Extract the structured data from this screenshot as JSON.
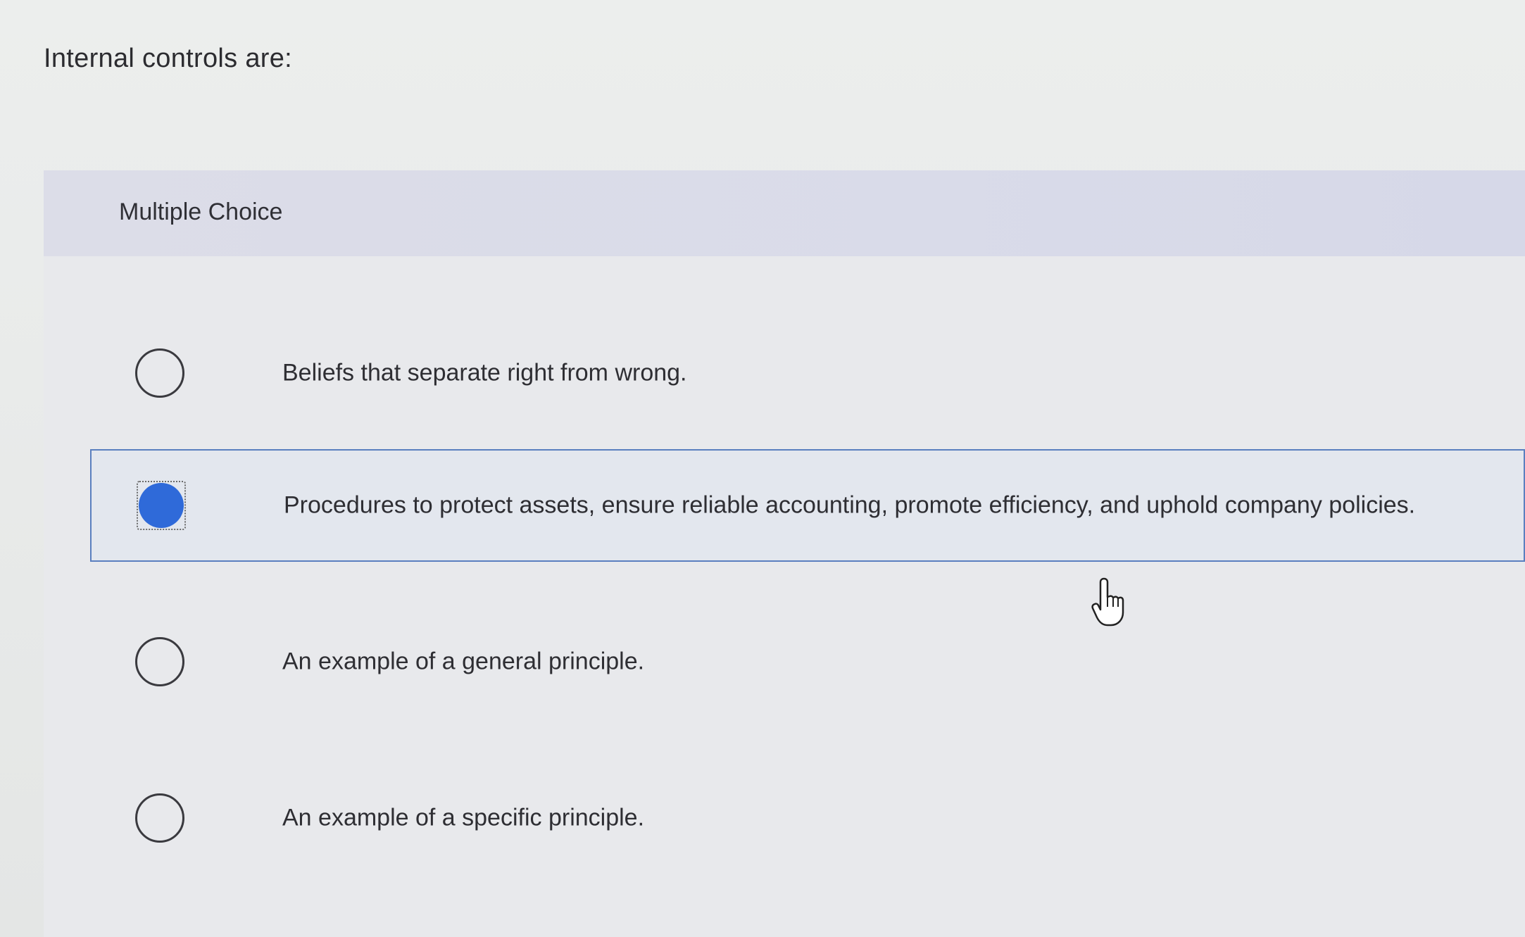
{
  "question": {
    "text": "Internal controls are:"
  },
  "multiple_choice": {
    "header_label": "Multiple Choice",
    "options": [
      {
        "label": "Beliefs that separate right from wrong.",
        "selected": false
      },
      {
        "label": "Procedures to protect assets, ensure reliable accounting, promote efficiency, and uphold company policies.",
        "selected": true
      },
      {
        "label": "An example of a general principle.",
        "selected": false
      },
      {
        "label": "An example of a specific principle.",
        "selected": false
      }
    ]
  },
  "colors": {
    "selected_radio": "#2f6ad9",
    "selected_border": "#5a7fbf",
    "header_background": "#d9dbe9"
  },
  "icons": {
    "cursor": "hand-pointer-icon",
    "radio": "radio-circle-icon"
  }
}
